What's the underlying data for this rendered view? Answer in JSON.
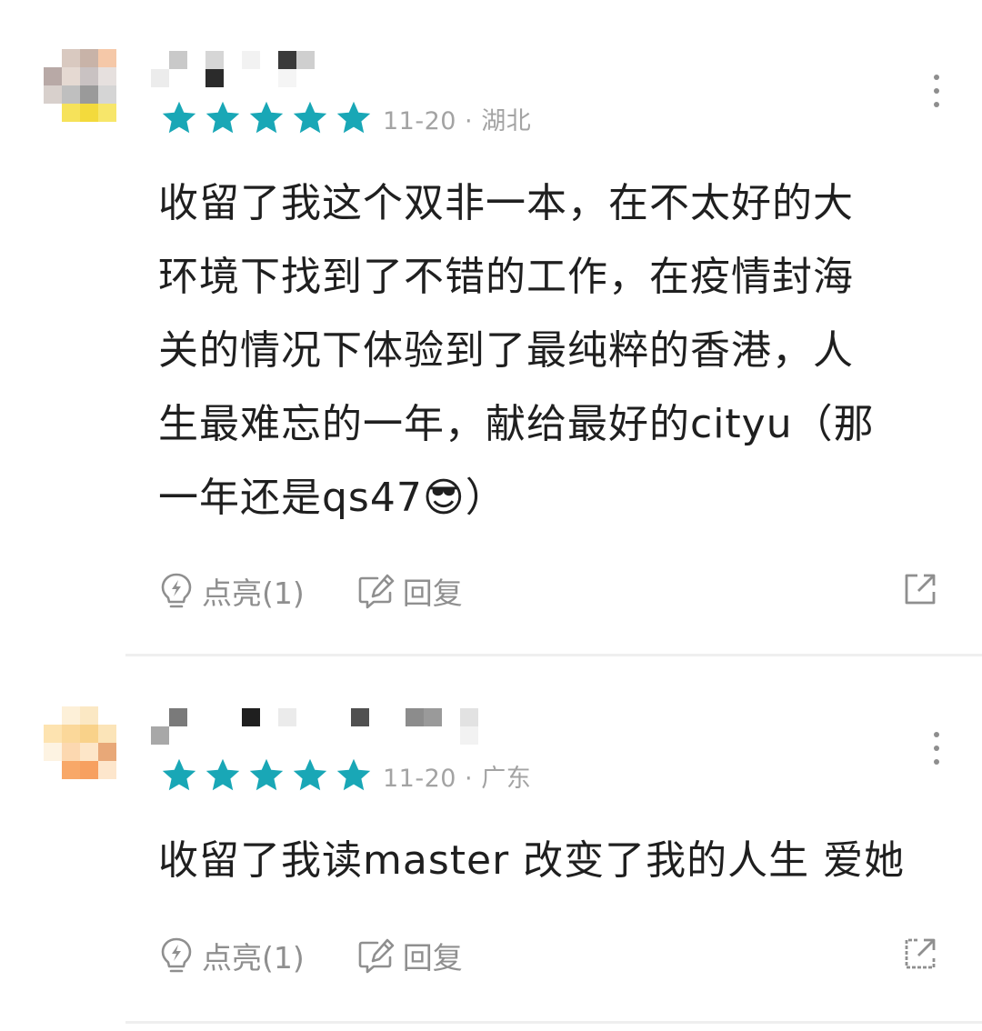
{
  "comments": [
    {
      "meta": "11-20 · 湖北",
      "rating": 5,
      "lines": [
        "收留了我这个双非一本，在不太好的大",
        "环境下找到了不错的工作，在疫情封海",
        "关的情况下体验到了最纯粹的香港，人",
        "生最难忘的一年，献给最好的cityu（那",
        "一年还是qs47😎）"
      ],
      "like_label": "点亮(1)",
      "reply_label": "回复"
    },
    {
      "meta": "11-20 · 广东",
      "rating": 5,
      "lines": [
        "收留了我读master 改变了我的人生 爱她"
      ],
      "like_label": "点亮(1)",
      "reply_label": "回复"
    }
  ],
  "colors": {
    "star": "#19a7b6",
    "meta_text": "#a3a3a3",
    "action_text": "#8f8f8f",
    "body_text": "#1f1f1f",
    "divider": "#efefef"
  },
  "icons": {
    "rating": "star-icon",
    "more": "more-vertical-icon",
    "like": "lightbulb-icon",
    "reply": "edit-reply-icon",
    "share": "share-external-icon"
  }
}
